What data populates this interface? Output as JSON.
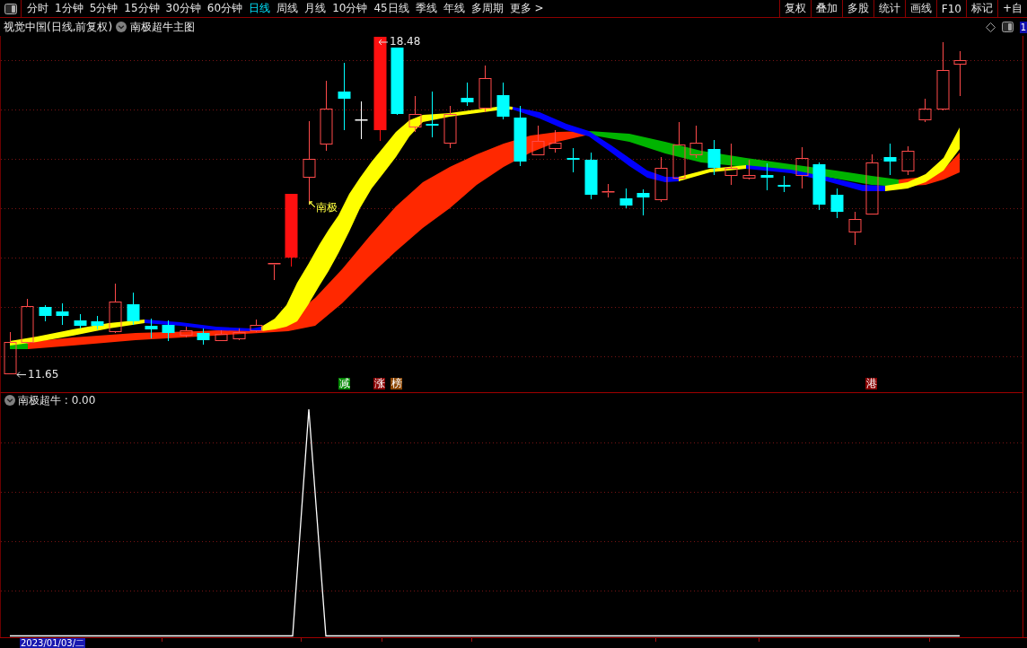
{
  "toolbar": {
    "period_tabs": [
      {
        "label": "分时",
        "selected": false
      },
      {
        "label": "1分钟",
        "selected": false
      },
      {
        "label": "5分钟",
        "selected": false
      },
      {
        "label": "15分钟",
        "selected": false
      },
      {
        "label": "30分钟",
        "selected": false
      },
      {
        "label": "60分钟",
        "selected": false
      },
      {
        "label": "日线",
        "selected": true
      },
      {
        "label": "周线",
        "selected": false
      },
      {
        "label": "月线",
        "selected": false
      },
      {
        "label": "10分钟",
        "selected": false
      },
      {
        "label": "45日线",
        "selected": false
      },
      {
        "label": "季线",
        "selected": false
      },
      {
        "label": "年线",
        "selected": false
      },
      {
        "label": "多周期",
        "selected": false
      }
    ],
    "more": "更多 >",
    "tools": [
      "复权",
      "叠加",
      "多股",
      "统计",
      "画线",
      "F10",
      "标记",
      "+自"
    ]
  },
  "chart_header": {
    "title": "视觉中国(日线,前复权)",
    "indicator": "南极超牛主图",
    "page_badge": "1"
  },
  "main_chart": {
    "high_label": "18.48",
    "low_label": "11.65",
    "signal_label": "南极",
    "event_badges": [
      {
        "text": "减",
        "color": "#008800"
      },
      {
        "text": "涨",
        "color": "#880000"
      },
      {
        "text": "榜",
        "color": "#8b4500"
      },
      {
        "text": "港",
        "color": "#880000"
      }
    ]
  },
  "indicator_pane": {
    "readout": "南极超牛 : 0.00"
  },
  "time_axis": {
    "cursor_date": "2023/01/03/二"
  }
}
